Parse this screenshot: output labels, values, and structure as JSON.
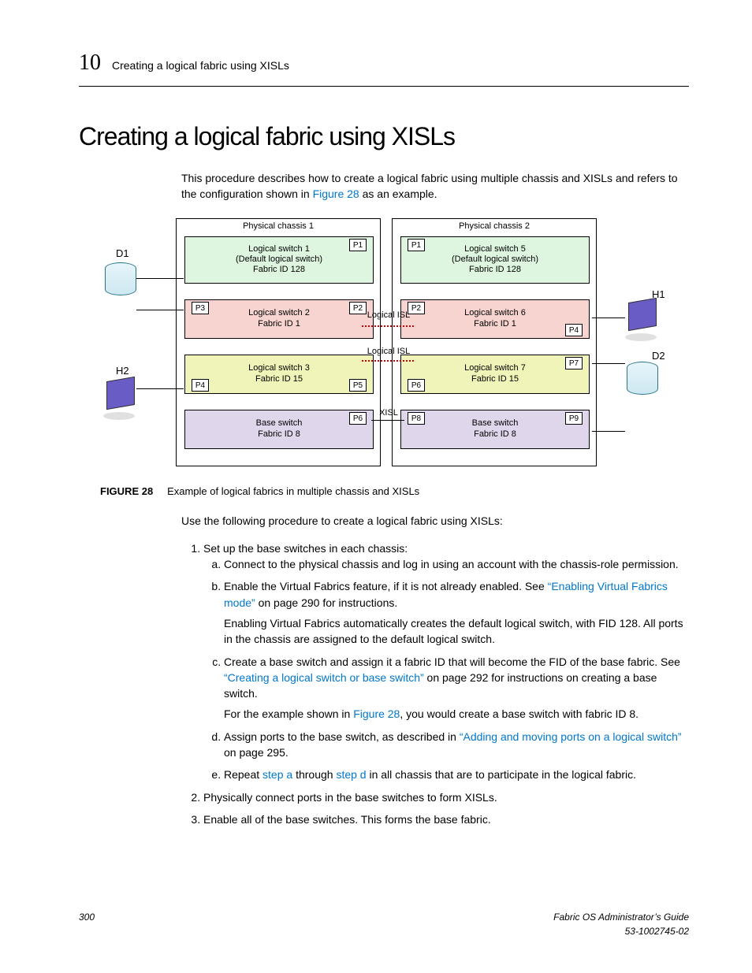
{
  "header": {
    "chapter_number": "10",
    "running_title": "Creating a logical fabric using XISLs"
  },
  "section_title": "Creating a logical fabric using XISLs",
  "intro_pre": "This procedure describes how to create a logical fabric using multiple chassis and XISLs and refers to the configuration shown in ",
  "intro_link": "Figure 28",
  "intro_post": " as an example.",
  "figure": {
    "label": "FIGURE 28",
    "caption": "Example of logical fabrics in multiple chassis and XISLs",
    "chassis1": "Physical chassis 1",
    "chassis2": "Physical chassis 2",
    "ls1_l1": "Logical switch 1",
    "ls1_l2": "(Default logical switch)",
    "ls1_l3": "Fabric ID 128",
    "ls2_l1": "Logical switch 2",
    "ls2_l2": "Fabric ID 1",
    "ls3_l1": "Logical switch 3",
    "ls3_l2": "Fabric ID 15",
    "bs1_l1": "Base switch",
    "bs1_l2": "Fabric ID 8",
    "ls5_l1": "Logical switch 5",
    "ls5_l2": "(Default logical switch)",
    "ls5_l3": "Fabric ID 128",
    "ls6_l1": "Logical switch 6",
    "ls6_l2": "Fabric ID 1",
    "ls7_l1": "Logical switch 7",
    "ls7_l2": "Fabric ID 15",
    "bs2_l1": "Base switch",
    "bs2_l2": "Fabric ID 8",
    "logical_isl": "Logical ISL",
    "xisl": "XISL",
    "d1": "D1",
    "d2": "D2",
    "h1": "H1",
    "h2": "H2",
    "p1": "P1",
    "p2": "P2",
    "p3": "P3",
    "p4": "P4",
    "p5": "P5",
    "p6": "P6",
    "p7": "P7",
    "p8": "P8",
    "p9": "P9"
  },
  "lead_in": "Use the following procedure to create a logical fabric using XISLs:",
  "step1": "Set up the base switches in each chassis:",
  "step1a": "Connect to the physical chassis and log in using an account with the chassis-role permission.",
  "step1b_pre": "Enable the Virtual Fabrics feature, if it is not already enabled. See ",
  "step1b_link": "“Enabling Virtual Fabrics mode”",
  "step1b_post": " on page 290 for instructions.",
  "step1b_after": "Enabling Virtual Fabrics automatically creates the default logical switch, with FID 128. All ports in the chassis are assigned to the default logical switch.",
  "step1c_pre": "Create a base switch and assign it a fabric ID that will become the FID of the base fabric. See ",
  "step1c_link": "“Creating a logical switch or base switch”",
  "step1c_post": " on page 292 for instructions on creating a base switch.",
  "step1c_after_pre": "For the example shown in ",
  "step1c_after_link": "Figure 28",
  "step1c_after_post": ", you would create a base switch with fabric ID 8.",
  "step1d_pre": "Assign ports to the base switch, as described in ",
  "step1d_link": "“Adding and moving ports on a logical switch”",
  "step1d_post": " on page 295.",
  "step1e_pre": "Repeat ",
  "step1e_link1": "step a",
  "step1e_mid": " through ",
  "step1e_link2": "step d",
  "step1e_post": " in all chassis that are to participate in the logical fabric.",
  "step2": "Physically connect ports in the base switches to form XISLs.",
  "step3": "Enable all of the base switches. This forms the base fabric.",
  "footer": {
    "page": "300",
    "guide": "Fabric OS Administrator’s Guide",
    "docnum": "53-1002745-02"
  }
}
